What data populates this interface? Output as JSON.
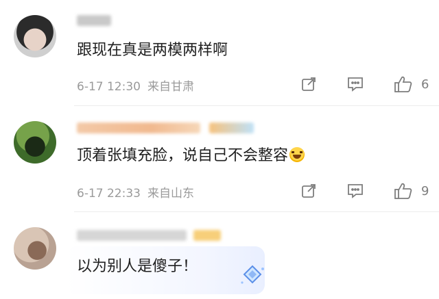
{
  "comments": [
    {
      "text": "跟现在真是两模两样啊",
      "date": "6-17 12:30",
      "location": "来自甘肃",
      "likes": "6"
    },
    {
      "text": "顶着张填充脸，说自己不会整容",
      "emoji": "laughing-tears-emoji",
      "date": "6-17 22:33",
      "location": "来自山东",
      "likes": "9"
    },
    {
      "text": "以为别人是傻子！"
    }
  ],
  "colors": {
    "text": "#1f1f1f",
    "meta": "#9a9a9a",
    "icon": "#7d7d7d"
  }
}
